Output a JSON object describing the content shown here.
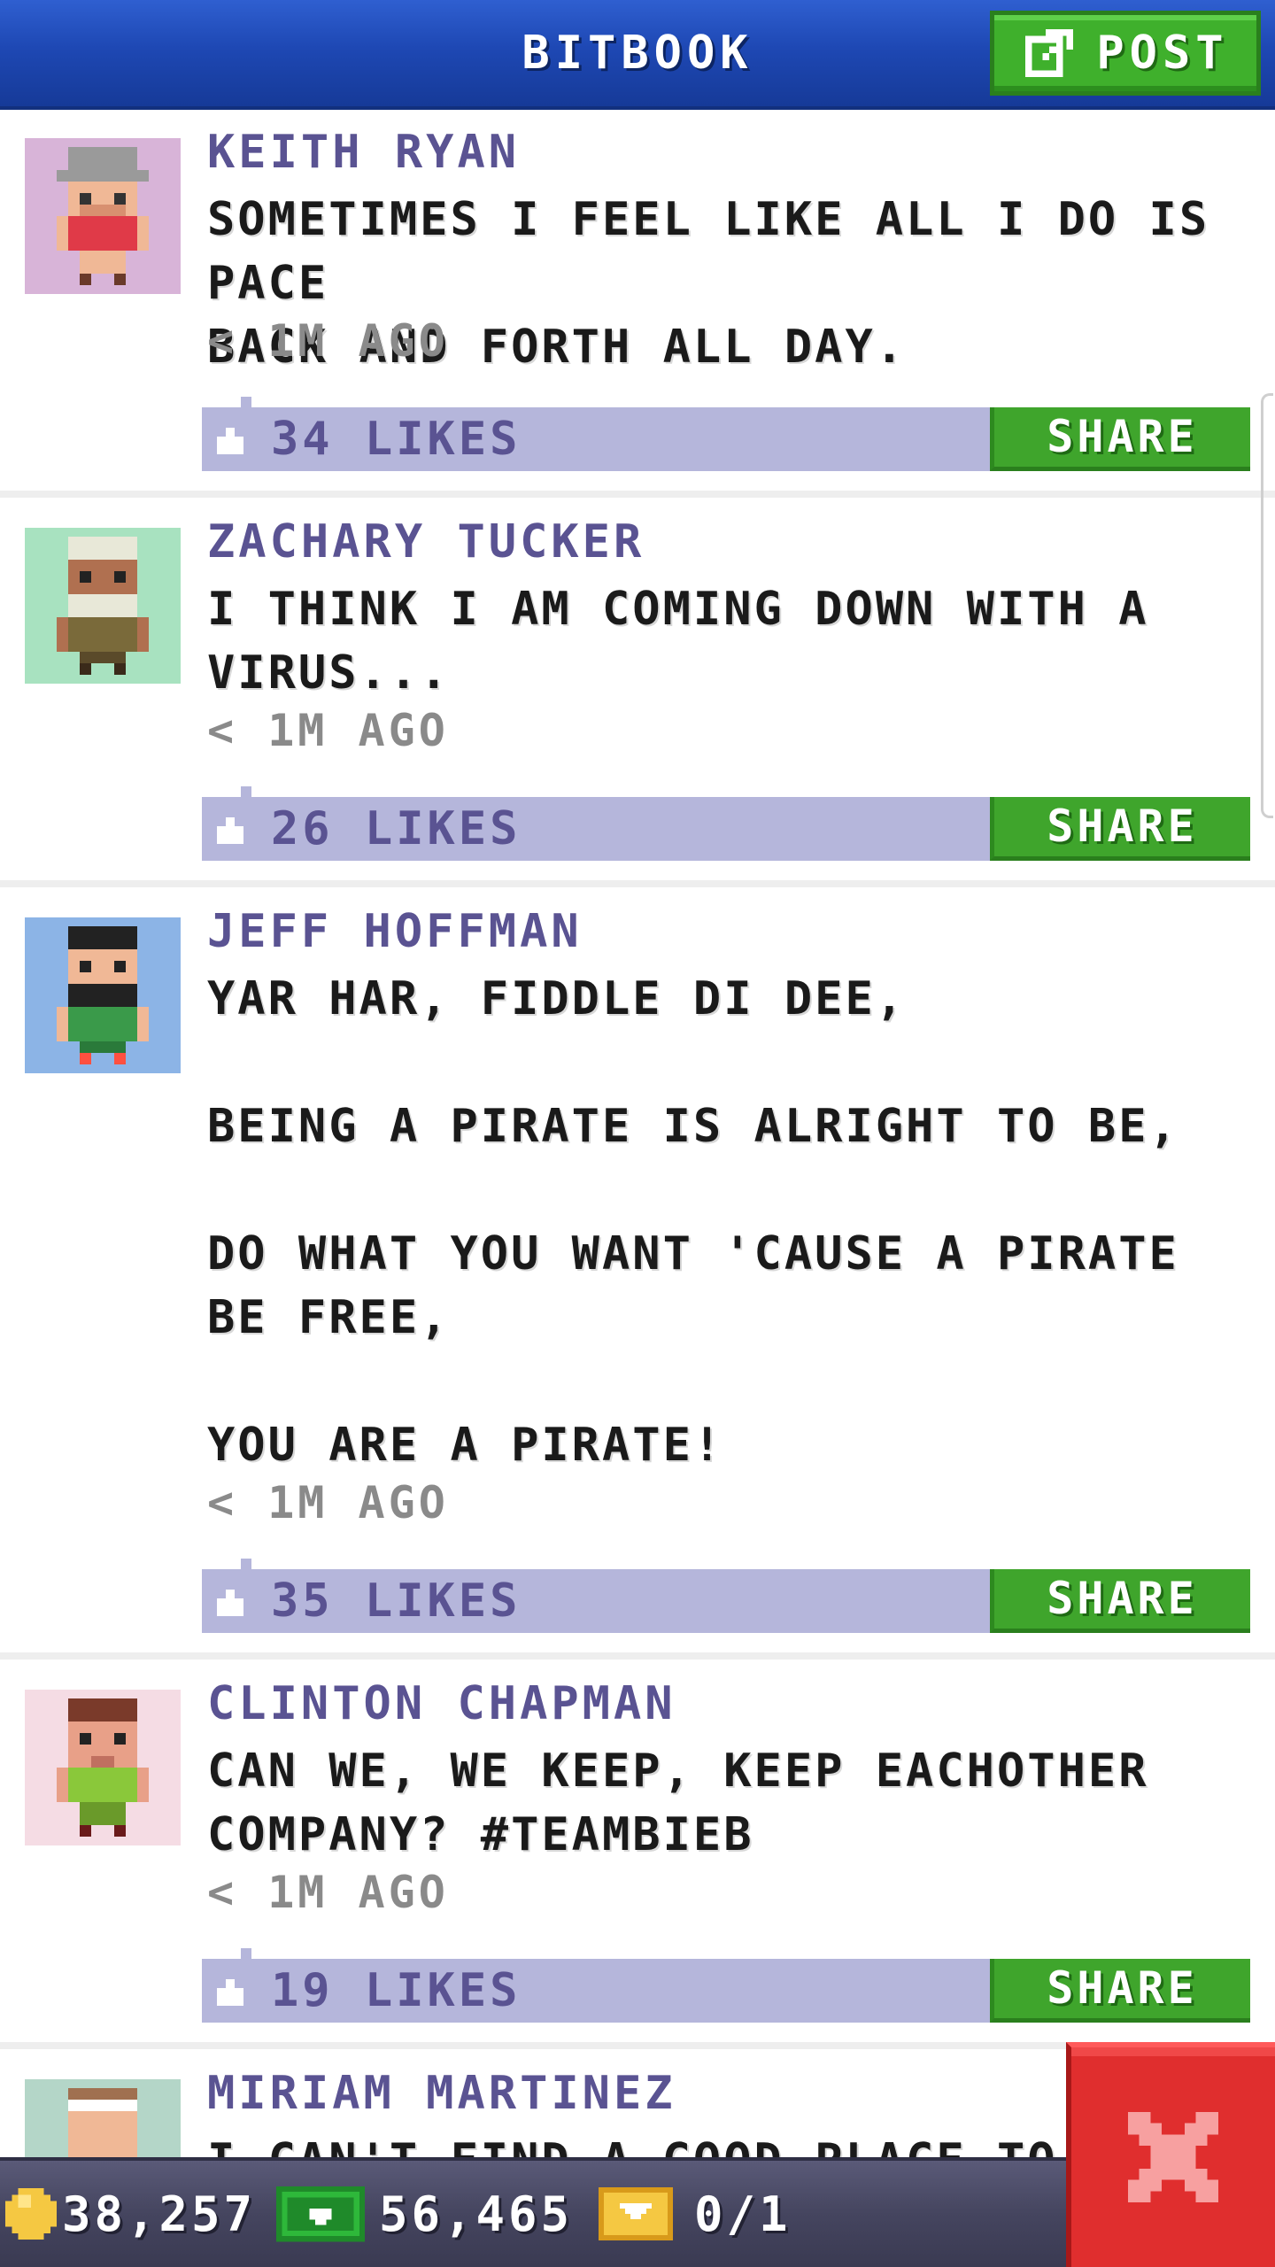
{
  "header": {
    "title": "BITBOOK",
    "post_label": "POST",
    "post_icon": "compose-icon"
  },
  "posts": [
    {
      "author": "KEITH RYAN",
      "message": "SOMETIMES I FEEL LIKE ALL I DO IS PACE\nBACK AND FORTH ALL DAY.",
      "time": "< 1M AGO",
      "likes": "34 LIKES",
      "share_label": "SHARE",
      "avatar_bg": "#d8b4d8"
    },
    {
      "author": "ZACHARY TUCKER",
      "message": "I THINK I AM COMING DOWN WITH A\nVIRUS...",
      "time": "< 1M AGO",
      "likes": "26 LIKES",
      "share_label": "SHARE",
      "avatar_bg": "#a8e2c0"
    },
    {
      "author": "JEFF HOFFMAN",
      "message": "YAR HAR, FIDDLE DI DEE,\n\nBEING A PIRATE IS ALRIGHT TO BE,\n\nDO WHAT YOU WANT 'CAUSE A PIRATE\nBE FREE,\n\nYOU ARE A PIRATE!",
      "time": "< 1M AGO",
      "likes": "35 LIKES",
      "share_label": "SHARE",
      "avatar_bg": "#8cb4e6"
    },
    {
      "author": "CLINTON CHAPMAN",
      "message": "CAN WE, WE KEEP, KEEP EACHOTHER\nCOMPANY? #TEAMBIEB",
      "time": "< 1M AGO",
      "likes": "19 LIKES",
      "share_label": "SHARE",
      "avatar_bg": "#f5dce4"
    },
    {
      "author": "MIRIAM MARTINEZ",
      "message": "I CAN'T FIND A GOOD PLACE TO",
      "time": "",
      "likes": "",
      "share_label": "",
      "avatar_bg": "#b4d6c8"
    }
  ],
  "status_bar": {
    "coins": "38,257",
    "cash": "56,465",
    "tickets": "0/1"
  },
  "colors": {
    "header_blue": "#1e48b4",
    "accent_green": "#3fa52c",
    "like_bar": "#b5b6db",
    "author_purple": "#5a5392",
    "close_red": "#e02e2e"
  }
}
